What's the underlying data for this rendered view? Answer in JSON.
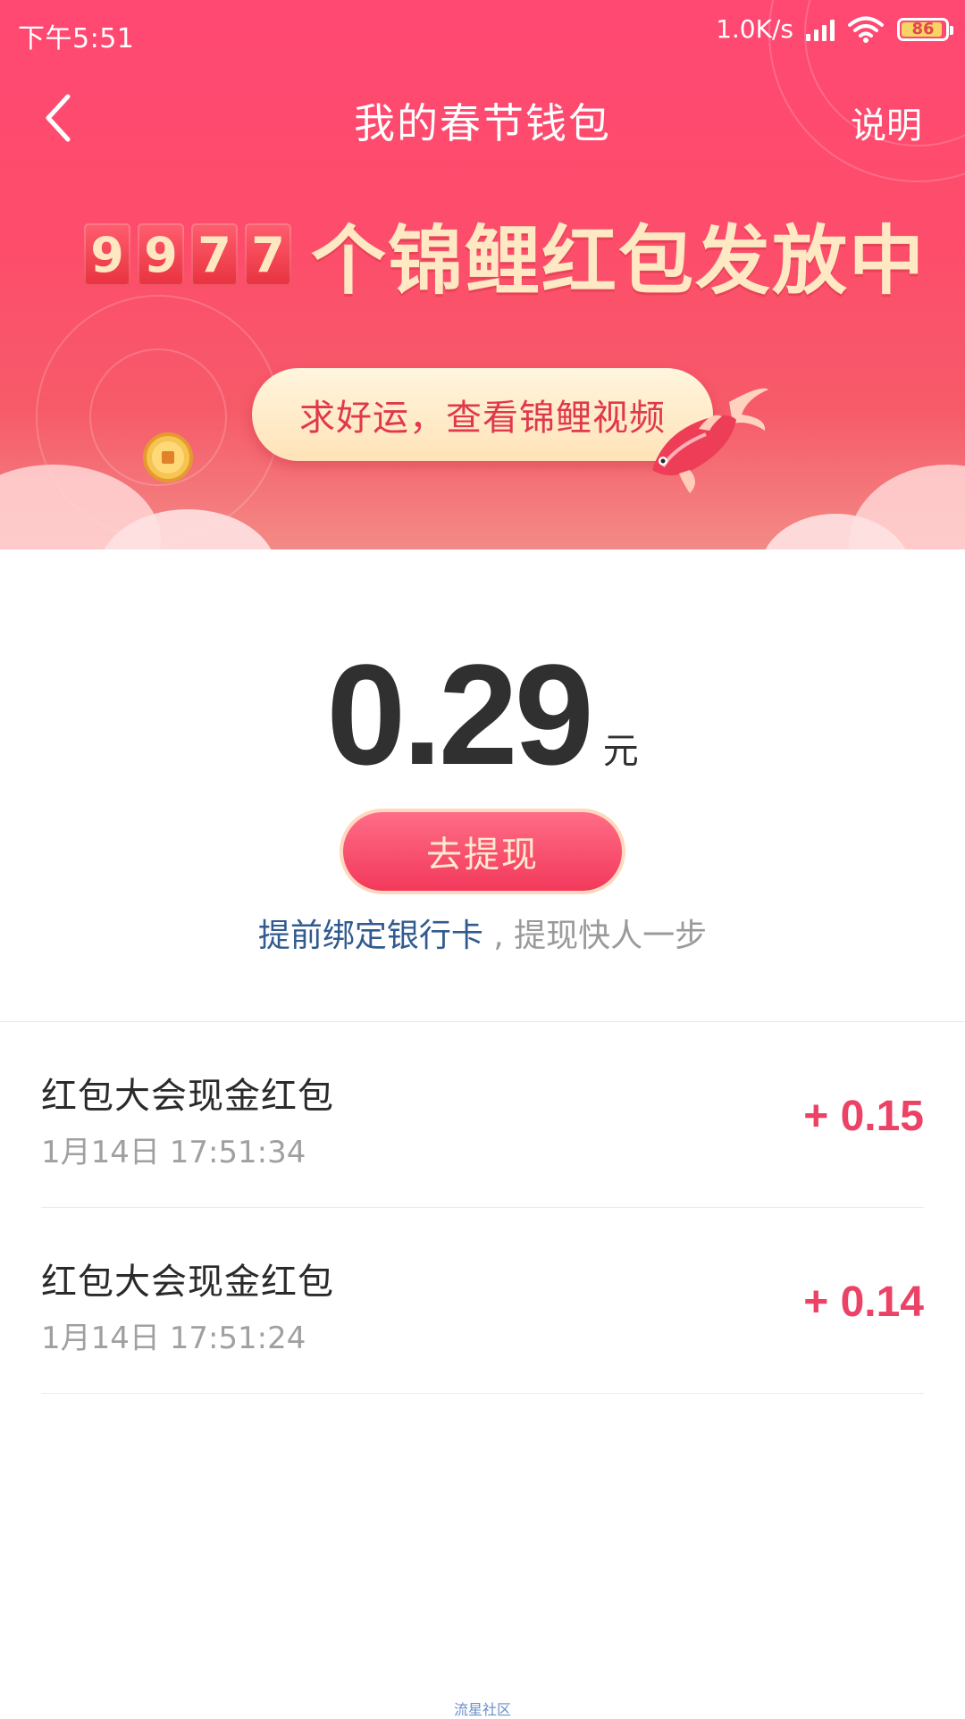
{
  "status_bar": {
    "time": "下午5:51",
    "net_speed": "1.0K/s",
    "battery": "86"
  },
  "nav": {
    "title": "我的春节钱包",
    "help_label": "说明"
  },
  "banner": {
    "counter_digits": [
      "9",
      "9",
      "7",
      "7"
    ],
    "headline": "个锦鲤红包发放中",
    "luck_button_label": "求好运，查看锦鲤视频"
  },
  "balance": {
    "amount": "0.29",
    "unit": "元",
    "withdraw_label": "去提现",
    "bind_link": "提前绑定银行卡",
    "bind_suffix": " , 提现快人一步"
  },
  "transactions": [
    {
      "title": "红包大会现金红包",
      "time": "1月14日 17:51:34",
      "amount": "+ 0.15"
    },
    {
      "title": "红包大会现金红包",
      "time": "1月14日 17:51:24",
      "amount": "+ 0.14"
    }
  ],
  "footer": {
    "watermark": "流星社区"
  },
  "colors": {
    "hero_top": "#ff4872",
    "accent": "#eb4266",
    "link": "#315b8f",
    "gold_text": "#ffe8c4"
  }
}
